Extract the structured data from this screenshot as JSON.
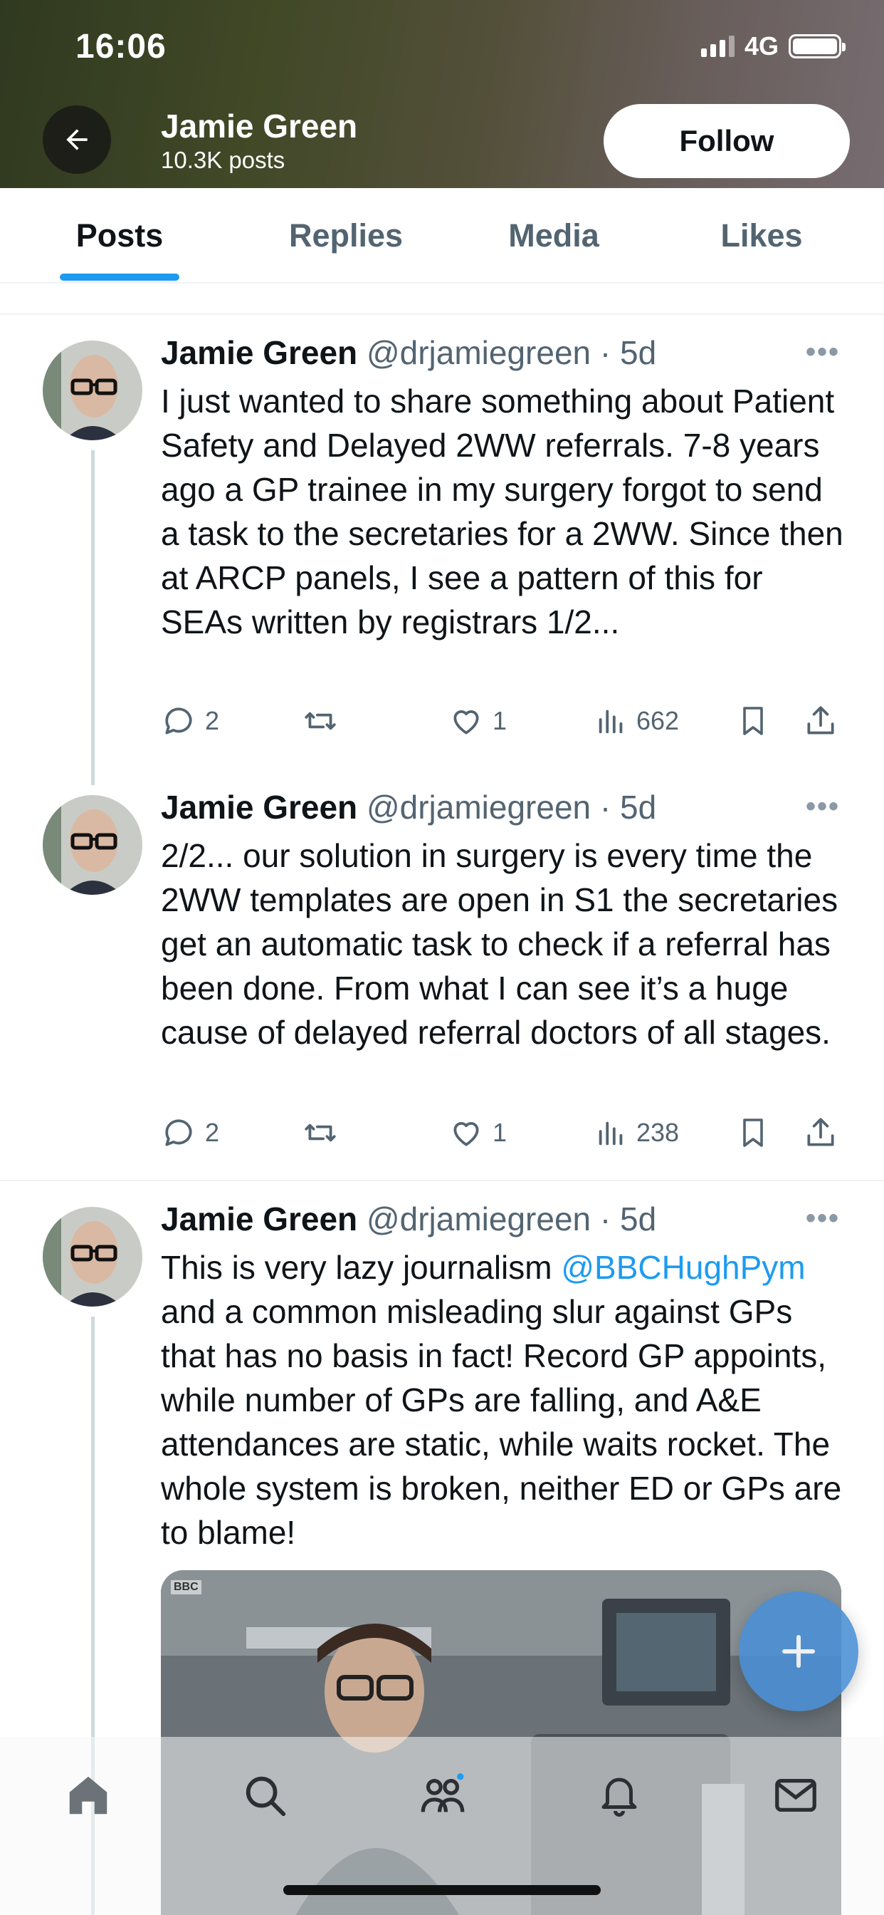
{
  "status_bar": {
    "time": "16:06",
    "network": "4G"
  },
  "header": {
    "name": "Jamie Green",
    "posts_count": "10.3K posts",
    "follow_label": "Follow"
  },
  "tabs": [
    {
      "label": "Posts",
      "active": true
    },
    {
      "label": "Replies",
      "active": false
    },
    {
      "label": "Media",
      "active": false
    },
    {
      "label": "Likes",
      "active": false
    }
  ],
  "tweets": [
    {
      "name": "Jamie Green",
      "handle": "@drjamiegreen",
      "time": "5d",
      "text": "I just wanted to share something about Patient Safety and Delayed 2WW referrals. 7-8 years ago a GP trainee in my surgery forgot to send a task to the secretaries for a 2WW. Since then at ARCP panels, I see a pattern of this for SEAs written by registrars 1/2...",
      "replies": "2",
      "likes": "1",
      "views": "662"
    },
    {
      "name": "Jamie Green",
      "handle": "@drjamiegreen",
      "time": "5d",
      "text": "2/2... our solution in surgery is every time the 2WW templates are open in S1 the secretaries get an automatic task to check if a referral has been done. From what I can see it’s a huge cause of delayed referral doctors of all stages.",
      "replies": "2",
      "likes": "1",
      "views": "238"
    },
    {
      "name": "Jamie Green",
      "handle": "@drjamiegreen",
      "time": "5d",
      "text_before": "This is very lazy journalism ",
      "mention": "@BBCHughPym",
      "text_after": " and a common misleading slur against GPs that has no basis in fact! Record GP appoints, while number of GPs are falling, and A&E attendances are static, while waits rocket. The whole system is broken, neither ED or GPs are to blame!",
      "media_label": "BBC"
    }
  ],
  "icons": {
    "back": "arrow-left-icon",
    "more": "ellipsis-icon",
    "reply": "speech-bubble-icon",
    "repost": "repost-icon",
    "like": "heart-icon",
    "views": "bar-chart-icon",
    "bookmark": "bookmark-icon",
    "share": "share-icon",
    "compose": "plus-icon",
    "nav": [
      "home-icon",
      "search-icon",
      "communities-icon",
      "bell-icon",
      "mail-icon"
    ]
  },
  "colors": {
    "accent": "#1d9bf0",
    "text": "#0f1419",
    "muted": "#536471"
  }
}
